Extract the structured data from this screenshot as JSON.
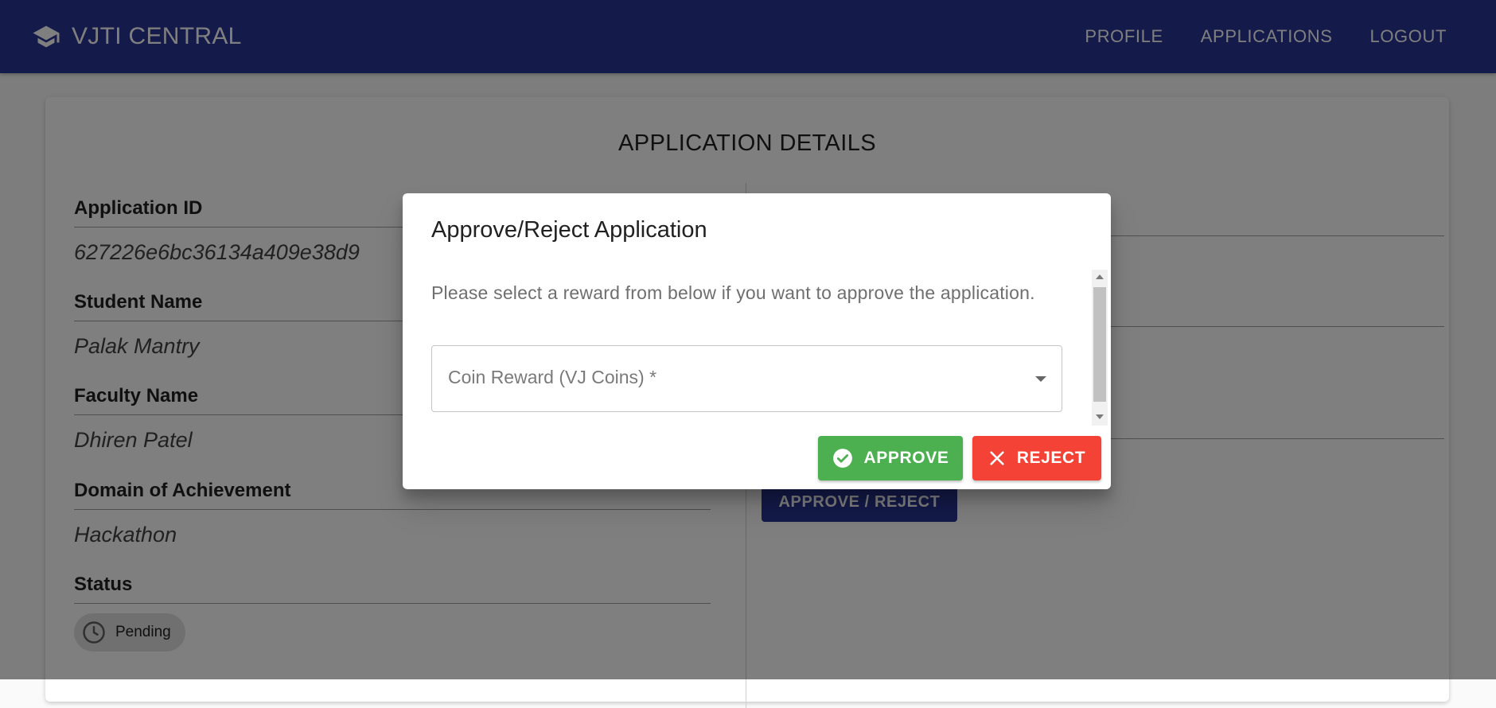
{
  "appbar": {
    "title": "VJTI CENTRAL",
    "logo_icon": "school-cap-icon",
    "nav": [
      {
        "label": "PROFILE"
      },
      {
        "label": "APPLICATIONS"
      },
      {
        "label": "LOGOUT"
      }
    ]
  },
  "details": {
    "title": "APPLICATION DETAILS",
    "fields": [
      {
        "label": "Application ID",
        "value": "627226e6bc36134a409e38d9"
      },
      {
        "label": "Student Name",
        "value": "Palak Mantry"
      },
      {
        "label": "Faculty Name",
        "value": "Dhiren Patel"
      },
      {
        "label": "Domain of Achievement",
        "value": "Hackathon"
      },
      {
        "label": "Status"
      }
    ],
    "status_chip": {
      "label": "Pending",
      "icon": "clock-icon"
    },
    "approve_reject_label": "APPROVE / REJECT"
  },
  "dialog": {
    "title": "Approve/Reject Application",
    "text": "Please select a reward from below if you want to approve the application.",
    "select_label": "Coin Reward (VJ Coins) *",
    "approve_label": "APPROVE",
    "reject_label": "REJECT"
  },
  "colors": {
    "primary": "#283593",
    "approve": "#4caf50",
    "reject": "#f44336"
  }
}
